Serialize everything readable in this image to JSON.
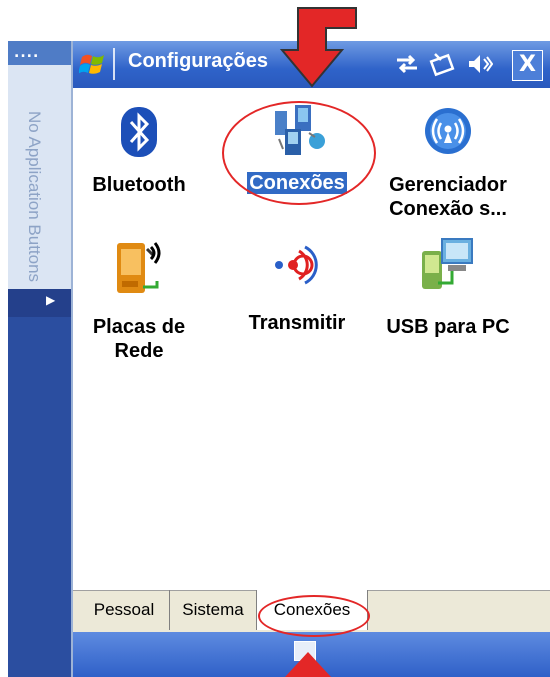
{
  "sidebar": {
    "label": "No Application Buttons",
    "grip": "....",
    "button_glyph": "▶"
  },
  "titlebar": {
    "title": "Configurações",
    "icons": [
      "windows-flag-icon",
      "connectivity-icon",
      "battery-icon",
      "volume-icon"
    ],
    "close_label": "X"
  },
  "items": [
    {
      "label_lines": [
        "Bluetooth"
      ],
      "icon": "bluetooth-icon"
    },
    {
      "label_lines": [
        "Conexões"
      ],
      "icon": "connections-icon",
      "selected": true
    },
    {
      "label_lines": [
        "Gerenciador",
        "Conexão s..."
      ],
      "icon": "wireless-manager-icon"
    },
    {
      "label_lines": [
        "Placas de",
        "Rede"
      ],
      "icon": "network-cards-icon"
    },
    {
      "label_lines": [
        "Transmitir"
      ],
      "icon": "beam-icon"
    },
    {
      "label_lines": [
        "USB para PC"
      ],
      "icon": "usb-to-pc-icon"
    }
  ],
  "tabs": [
    {
      "label": "Pessoal"
    },
    {
      "label": "Sistema"
    },
    {
      "label": "Conexões",
      "active": true
    }
  ],
  "colors": {
    "accent": "#316ac5",
    "annotation": "#e32727",
    "titlebar": "#2f63c9"
  }
}
